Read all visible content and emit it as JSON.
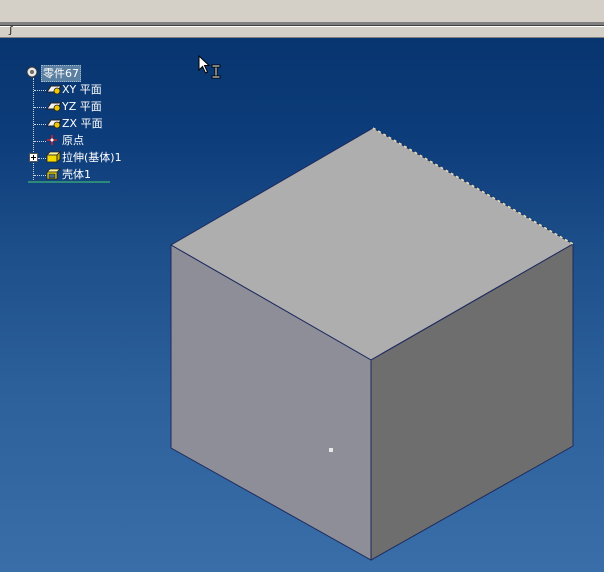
{
  "header": {
    "sub_mark": "ʃ"
  },
  "tree": {
    "root": "零件67",
    "items": [
      {
        "label": "XY 平面",
        "icon": "plane-icon"
      },
      {
        "label": "YZ 平面",
        "icon": "plane-icon"
      },
      {
        "label": "ZX 平面",
        "icon": "plane-icon"
      },
      {
        "label": "原点",
        "icon": "origin-icon"
      },
      {
        "label": "拉伸(基体)1",
        "icon": "extrude-icon"
      },
      {
        "label": "壳体1",
        "icon": "shell-icon"
      }
    ]
  },
  "colors": {
    "cube_top": "#aeaeae",
    "cube_left": "#8e8e98",
    "cube_right": "#6e6e6e",
    "cube_edge": "#1e2a5e",
    "viewport_top": "#08356f",
    "viewport_bottom": "#3a6ea8"
  }
}
